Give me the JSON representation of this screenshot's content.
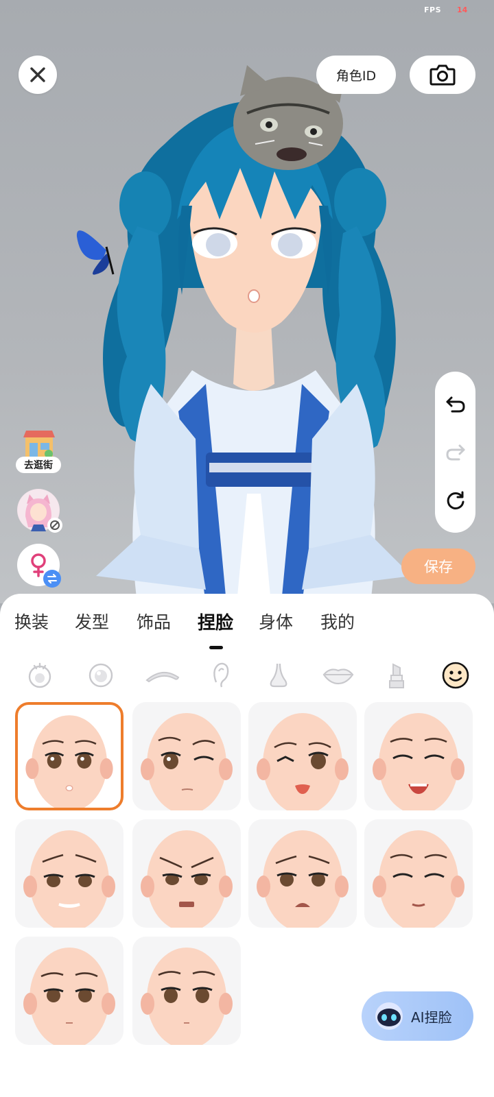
{
  "stats": {
    "fps_label": "FPS",
    "fps_value": "14"
  },
  "top_bar": {
    "role_id_label": "角色ID"
  },
  "side": {
    "street_label": "去逛街"
  },
  "save_label": "保存",
  "tabs": [
    "换装",
    "发型",
    "饰品",
    "捏脸",
    "身体",
    "我的"
  ],
  "active_tab": "捏脸",
  "subcategories": [
    "head-shape-icon",
    "eye-icon",
    "eyebrow-icon",
    "ear-icon",
    "nose-icon",
    "lips-icon",
    "lipstick-icon",
    "face-expression-icon"
  ],
  "active_subcategory": "face-expression-icon",
  "expressions": [
    {
      "id": "neutral",
      "selected": true
    },
    {
      "id": "wink",
      "selected": false
    },
    {
      "id": "tongue-out",
      "selected": false
    },
    {
      "id": "laughing",
      "selected": false
    },
    {
      "id": "worried-smile",
      "selected": false
    },
    {
      "id": "angry",
      "selected": false
    },
    {
      "id": "sad",
      "selected": false
    },
    {
      "id": "smug",
      "selected": false
    },
    {
      "id": "calm",
      "selected": false
    },
    {
      "id": "blank",
      "selected": false
    }
  ],
  "ai_button_label": "AI捏脸",
  "colors": {
    "accent": "#ee7d2c",
    "save": "#f7b183",
    "ai": "#a8c8f8"
  }
}
